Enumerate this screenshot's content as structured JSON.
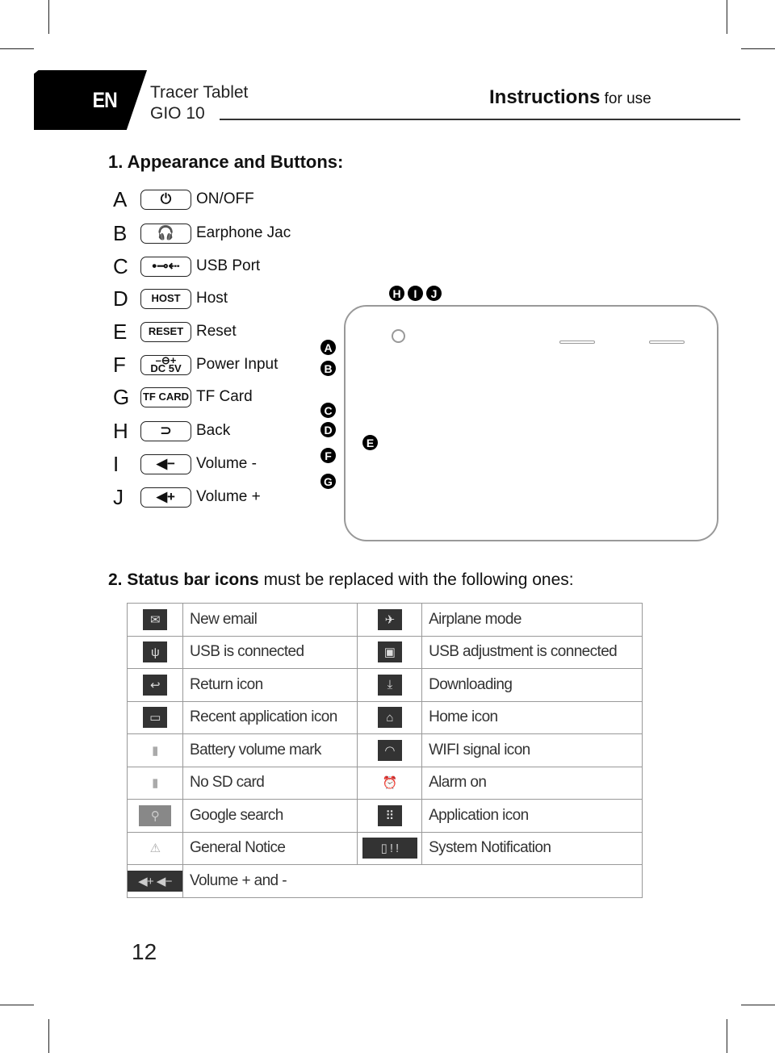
{
  "header": {
    "lang": "EN",
    "product_line1": "Tracer Tablet",
    "product_line2": "GIO 10",
    "instructions_bold": "Instructions",
    "instructions_rest": " for use"
  },
  "section1": {
    "title": "1. Appearance and Buttons:",
    "buttons": [
      {
        "letter": "A",
        "icon": "power-icon",
        "glyph": "⏻",
        "label": "ON/OFF"
      },
      {
        "letter": "B",
        "icon": "headphones-icon",
        "glyph": "🎧",
        "label": "Earphone Jac"
      },
      {
        "letter": "C",
        "icon": "usb-icon",
        "glyph": "•⊸⇠",
        "label": "USB Port"
      },
      {
        "letter": "D",
        "icon": "host-text-icon",
        "glyph": "HOST",
        "label": "Host"
      },
      {
        "letter": "E",
        "icon": "reset-text-icon",
        "glyph": "RESET",
        "label": "Reset"
      },
      {
        "letter": "F",
        "icon": "dc-power-icon",
        "glyph": "–⊖+\nDC 5V",
        "label": "Power Input"
      },
      {
        "letter": "G",
        "icon": "tf-card-text-icon",
        "glyph": "TF CARD",
        "label": "TF Card"
      },
      {
        "letter": "H",
        "icon": "back-icon",
        "glyph": "⊃",
        "label": "Back"
      },
      {
        "letter": "I",
        "icon": "volume-down-icon",
        "glyph": "◀−",
        "label": "Volume -"
      },
      {
        "letter": "J",
        "icon": "volume-up-icon",
        "glyph": "◀+",
        "label": "Volume +"
      }
    ],
    "diagram_badges": [
      "A",
      "B",
      "C",
      "D",
      "E",
      "F",
      "G",
      "H",
      "I",
      "J"
    ]
  },
  "section2": {
    "title_bold": "2. Status bar icons",
    "title_rest": " must be replaced with the following ones:",
    "rows": [
      [
        {
          "icon": "mail-icon",
          "glyph": "✉",
          "label": "New email"
        },
        {
          "icon": "airplane-icon",
          "glyph": "✈",
          "label": "Airplane mode"
        }
      ],
      [
        {
          "icon": "usb-icon",
          "glyph": "ψ",
          "label": "USB is connected"
        },
        {
          "icon": "android-icon",
          "glyph": "▣",
          "label": "USB adjustment is connected"
        }
      ],
      [
        {
          "icon": "return-icon",
          "glyph": "↩",
          "label": "Return icon"
        },
        {
          "icon": "download-icon",
          "glyph": "⤓",
          "label": "Downloading"
        }
      ],
      [
        {
          "icon": "recent-apps-icon",
          "glyph": "▭",
          "label": "Recent application icon"
        },
        {
          "icon": "home-icon",
          "glyph": "⌂",
          "label": "Home icon"
        }
      ],
      [
        {
          "icon": "battery-icon",
          "glyph": "▮",
          "label": "Battery volume mark"
        },
        {
          "icon": "wifi-icon",
          "glyph": "◠",
          "label": "WIFI signal icon"
        }
      ],
      [
        {
          "icon": "no-sd-card-icon",
          "glyph": "▮",
          "label": "No SD card"
        },
        {
          "icon": "alarm-icon",
          "glyph": "⏰",
          "label": "Alarm on"
        }
      ],
      [
        {
          "icon": "search-icon",
          "glyph": "⚲",
          "label": "Google search"
        },
        {
          "icon": "apps-grid-icon",
          "glyph": "⠿",
          "label": "Application icon"
        }
      ],
      [
        {
          "icon": "warning-icon",
          "glyph": "⚠",
          "label": "General Notice"
        },
        {
          "icon": "system-notification-icon",
          "glyph": "▯ ! !",
          "label": "System Notification"
        }
      ]
    ],
    "last_row": {
      "icon": "volume-up-down-icon",
      "glyph": "◀+ ◀−",
      "label": "Volume + and -"
    }
  },
  "footer": {
    "page_number": "12"
  }
}
